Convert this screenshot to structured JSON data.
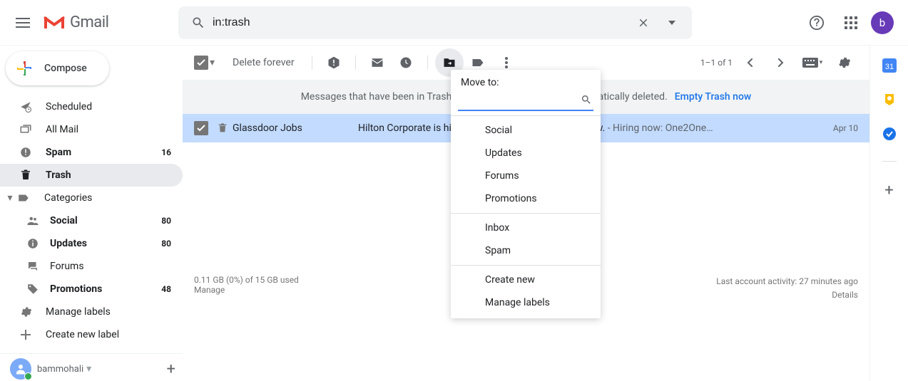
{
  "header": {
    "product": "Gmail",
    "search_value": "in:trash",
    "avatar_letter": "b"
  },
  "sidebar": {
    "compose": "Compose",
    "items": [
      {
        "label": "Scheduled",
        "count": ""
      },
      {
        "label": "All Mail",
        "count": ""
      },
      {
        "label": "Spam",
        "count": "16"
      },
      {
        "label": "Trash",
        "count": ""
      },
      {
        "label": "Categories",
        "count": ""
      }
    ],
    "categories": [
      {
        "label": "Social",
        "count": "80"
      },
      {
        "label": "Updates",
        "count": "80"
      },
      {
        "label": "Forums",
        "count": ""
      },
      {
        "label": "Promotions",
        "count": "48"
      }
    ],
    "manage_labels": "Manage labels",
    "create_label": "Create new label",
    "hangouts_user": "bammohali"
  },
  "toolbar": {
    "delete_forever": "Delete forever",
    "page_count": "1–1 of 1"
  },
  "notice": {
    "text": "Messages that have been in Trash more than 30 days will be automatically deleted.",
    "action": "Empty Trash now"
  },
  "mail": {
    "sender": "Glassdoor Jobs",
    "subject": "Hilton Corporate is hiring in Gurgaon (India). Apply Now.",
    "snippet": " - Hiring now: One2One…",
    "date": "Apr 10"
  },
  "footer": {
    "storage": "0.11 GB (0%) of 15 GB used",
    "manage": "Manage",
    "activity": "Last account activity: 27 minutes ago",
    "details": "Details"
  },
  "popup": {
    "title": "Move to:",
    "groups": [
      [
        "Social",
        "Updates",
        "Forums",
        "Promotions"
      ],
      [
        "Inbox",
        "Spam"
      ],
      [
        "Create new",
        "Manage labels"
      ]
    ]
  }
}
